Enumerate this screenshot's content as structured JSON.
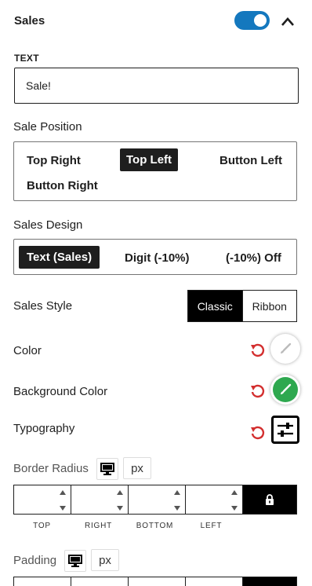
{
  "panel": {
    "title": "Sales",
    "enabled": true
  },
  "text_field": {
    "label": "TEXT",
    "value": "Sale!"
  },
  "sale_position": {
    "label": "Sale Position",
    "options": [
      "Top Right",
      "Top Left",
      "Button Left",
      "Button Right"
    ],
    "selected": "Top Left"
  },
  "sales_design": {
    "label": "Sales Design",
    "options": [
      "Text (Sales)",
      "Digit (-10%)",
      "(-10%) Off"
    ],
    "selected": "Text (Sales)"
  },
  "sales_style": {
    "label": "Sales Style",
    "options": [
      "Classic",
      "Ribbon"
    ],
    "selected": "Classic"
  },
  "color": {
    "label": "Color",
    "value": "#ffffff"
  },
  "background_color": {
    "label": "Background Color",
    "value": "#2ea84f"
  },
  "typography": {
    "label": "Typography"
  },
  "border_radius": {
    "label": "Border Radius",
    "unit": "px",
    "sides": [
      "TOP",
      "RIGHT",
      "BOTTOM",
      "LEFT"
    ],
    "values": [
      "",
      "",
      "",
      ""
    ]
  },
  "padding": {
    "label": "Padding",
    "unit": "px"
  },
  "colors": {
    "accent": "#1478be",
    "reset": "#d32f2f",
    "dark": "#1e1e1e"
  },
  "icons": [
    "chevron-up-icon",
    "reset-icon",
    "brush-icon",
    "sliders-icon",
    "desktop-icon",
    "lock-icon"
  ]
}
